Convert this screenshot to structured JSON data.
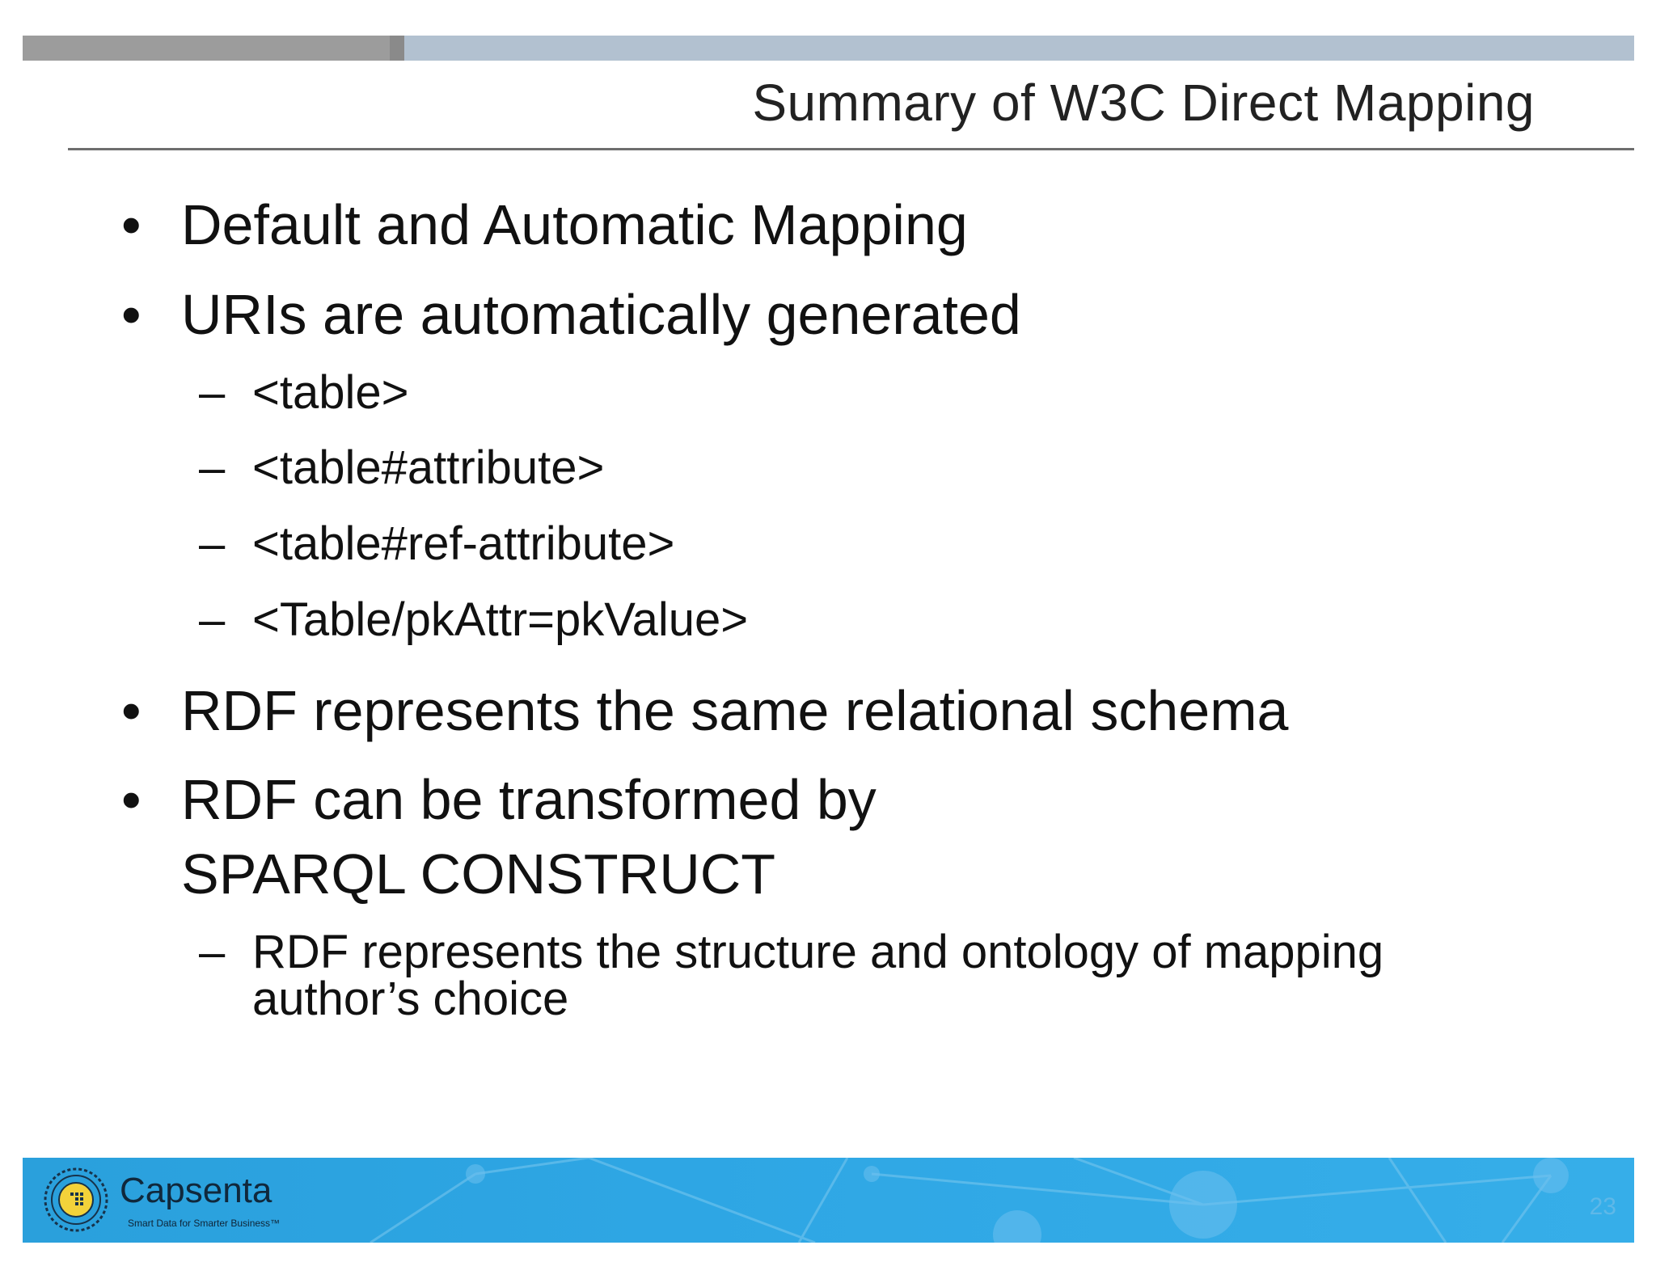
{
  "slide": {
    "title": "Summary of W3C Direct Mapping",
    "bullet_glyph": "•",
    "dash_glyph": "–",
    "items": [
      {
        "level": 1,
        "text": "Default and Automatic Mapping"
      },
      {
        "level": 1,
        "text": "URIs are automatically generated"
      },
      {
        "level": 2,
        "text": "<table>"
      },
      {
        "level": 2,
        "text": "<table#attribute>"
      },
      {
        "level": 2,
        "text": "<table#ref-attribute>"
      },
      {
        "level": 2,
        "text": "<Table/pkAttr=pkValue>"
      },
      {
        "level": 1,
        "text": "RDF represents the same relational schema"
      },
      {
        "level": 1,
        "text_line1": "RDF can be transformed by",
        "text_line2": "SPARQL CONSTRUCT"
      },
      {
        "level": 2,
        "text_line1": "RDF represents the structure and ontology of mapping",
        "text_line2": "author’s choice"
      }
    ]
  },
  "footer": {
    "brand": "Capsenta",
    "tagline": "Smart Data for Smarter Business™",
    "page_number": "23",
    "logo_icon": "capsenta-logo-icon",
    "colors": {
      "band": "#2ea6e4",
      "brand_text": "#10283c",
      "logo_yellow": "#f3d23a"
    }
  },
  "header": {
    "colors": {
      "bar_left": "#9c9c9c",
      "bar_right": "#b2c1d0",
      "rule": "#6e6e6e"
    }
  }
}
